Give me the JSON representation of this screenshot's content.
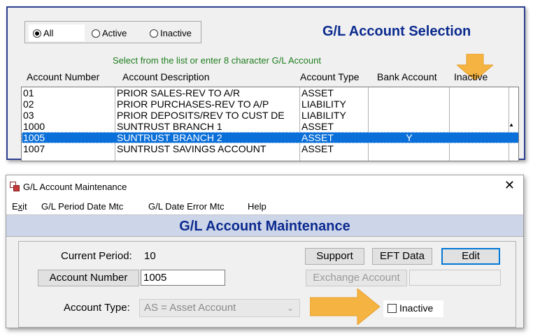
{
  "selection": {
    "filters": [
      {
        "label": "All",
        "selected": true
      },
      {
        "label": "Active",
        "selected": false
      },
      {
        "label": "Inactive",
        "selected": false
      }
    ],
    "title": "G/L Account Selection",
    "hint": "Select from the list or enter 8 character G/L Account",
    "columns": [
      "Account Number",
      "Account Description",
      "Account Type",
      "Bank Account",
      "Inactive"
    ],
    "rows": [
      {
        "number": "01",
        "description": "PRIOR SALES-REV TO A/R",
        "type": "ASSET",
        "bank": "",
        "inactive": ""
      },
      {
        "number": "02",
        "description": "PRIOR PURCHASES-REV TO A/P",
        "type": "LIABILITY",
        "bank": "",
        "inactive": ""
      },
      {
        "number": "03",
        "description": "PRIOR DEPOSITS/REV TO CUST DE",
        "type": "LIABILITY",
        "bank": "",
        "inactive": ""
      },
      {
        "number": "1000",
        "description": "SUNTRUST BRANCH 1",
        "type": "ASSET",
        "bank": "",
        "inactive": ""
      },
      {
        "number": "1005",
        "description": "SUNTRUST BRANCH 2",
        "type": "ASSET",
        "bank": "Y",
        "inactive": "",
        "selected": true
      },
      {
        "number": "1007",
        "description": "SUNTRUST SAVINGS ACCOUNT",
        "type": "ASSET",
        "bank": "",
        "inactive": ""
      }
    ],
    "scroll_icon": "scroll-down-arrow"
  },
  "maintenance": {
    "window_title": "G/L Account Maintenance",
    "close_glyph": "✕",
    "menu": [
      {
        "label": "Exit",
        "accel": "x"
      },
      {
        "label": "G/L Period Date Mtc"
      },
      {
        "label": "G/L Date Error Mtc"
      },
      {
        "label": "Help"
      }
    ],
    "header": "G/L Account Maintenance",
    "current_period_label": "Current Period:",
    "current_period_value": "10",
    "buttons": {
      "support": "Support",
      "eft": "EFT Data",
      "edit": "Edit",
      "account_number": "Account Number",
      "exchange_account": "Exchange Account"
    },
    "account_number_value": "1005",
    "exchange_account_value": "",
    "account_type_label": "Account Type:",
    "account_type_value": "AS = Asset Account",
    "inactive_label": "Inactive",
    "inactive_checked": false
  },
  "colors": {
    "title_blue": "#0b2a8f",
    "hint_green": "#1e7d1e",
    "selection_blue": "#0a6fd8",
    "callout_orange": "#f5b342"
  }
}
